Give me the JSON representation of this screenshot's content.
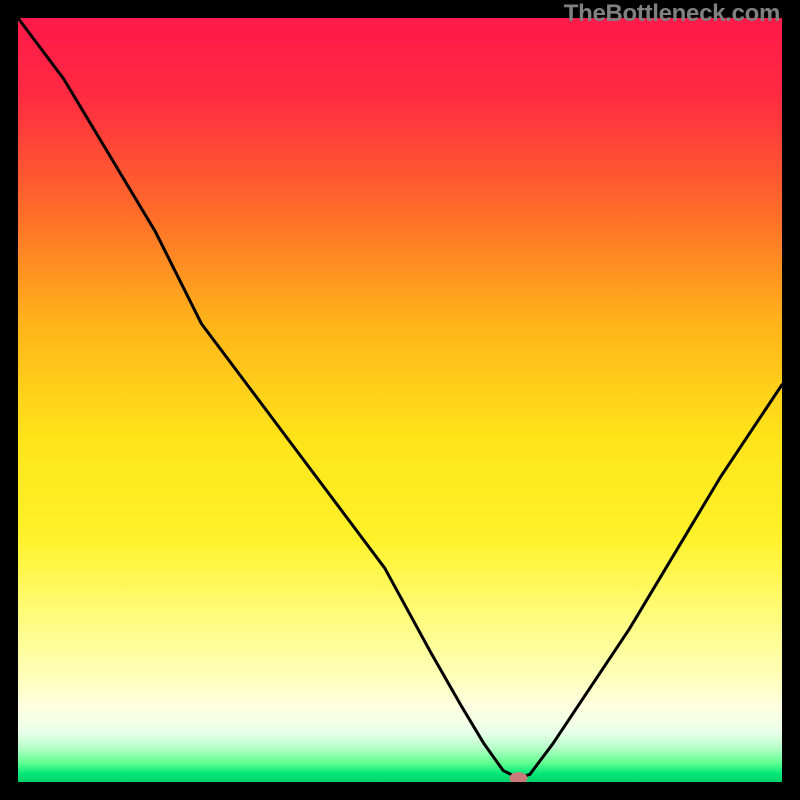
{
  "watermark": "TheBottleneck.com",
  "chart_data": {
    "type": "line",
    "title": "",
    "xlabel": "",
    "ylabel": "",
    "xlim": [
      0,
      100
    ],
    "ylim": [
      0,
      100
    ],
    "grid": false,
    "legend": false,
    "gradient_stops": [
      {
        "offset": 0.0,
        "color": "#ff1a4a"
      },
      {
        "offset": 0.1,
        "color": "#ff2a42"
      },
      {
        "offset": 0.25,
        "color": "#ff6a2a"
      },
      {
        "offset": 0.4,
        "color": "#ffb41a"
      },
      {
        "offset": 0.55,
        "color": "#ffe41a"
      },
      {
        "offset": 0.68,
        "color": "#fff22a"
      },
      {
        "offset": 0.78,
        "color": "#fffc7a"
      },
      {
        "offset": 0.86,
        "color": "#ffffb8"
      },
      {
        "offset": 0.9,
        "color": "#ffffe0"
      },
      {
        "offset": 0.935,
        "color": "#eaffea"
      },
      {
        "offset": 0.955,
        "color": "#b8ffc8"
      },
      {
        "offset": 0.975,
        "color": "#60ff90"
      },
      {
        "offset": 0.99,
        "color": "#00e676"
      },
      {
        "offset": 1.0,
        "color": "#00d26a"
      }
    ],
    "series": [
      {
        "name": "bottleneck-curve",
        "x": [
          0.0,
          6.0,
          12.0,
          18.0,
          24.0,
          30.0,
          36.0,
          42.0,
          48.0,
          54.0,
          58.0,
          61.0,
          63.5,
          65.5,
          67.0,
          70.0,
          74.0,
          80.0,
          86.0,
          92.0,
          98.0,
          100.0
        ],
        "y": [
          100,
          92.0,
          82.0,
          72.0,
          60.0,
          52.0,
          44.0,
          36.0,
          28.0,
          17.0,
          10.0,
          5.0,
          1.5,
          0.5,
          1.0,
          5.0,
          11.0,
          20.0,
          30.0,
          40.0,
          49.0,
          52.0
        ]
      }
    ],
    "marker": {
      "name": "optimal-point",
      "x": 65.5,
      "y": 0.5,
      "color": "#c97a7a",
      "rx": 9,
      "ry": 6
    }
  }
}
